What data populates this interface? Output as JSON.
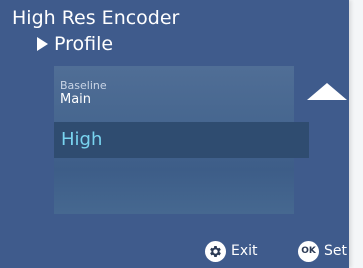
{
  "header": {
    "title": "High Res Encoder",
    "subtitle": "Profile"
  },
  "list": {
    "items": [
      {
        "caption": "Baseline",
        "value": "Main"
      },
      {
        "value": "High",
        "selected": true
      }
    ]
  },
  "footer": {
    "exit_label": "Exit",
    "exit_icon": "gear-icon",
    "set_label": "Set",
    "set_icon_text": "OK"
  },
  "colors": {
    "background": "#3f5b8c",
    "selected_row": "#2f4c70",
    "selected_text": "#79d4f0"
  }
}
